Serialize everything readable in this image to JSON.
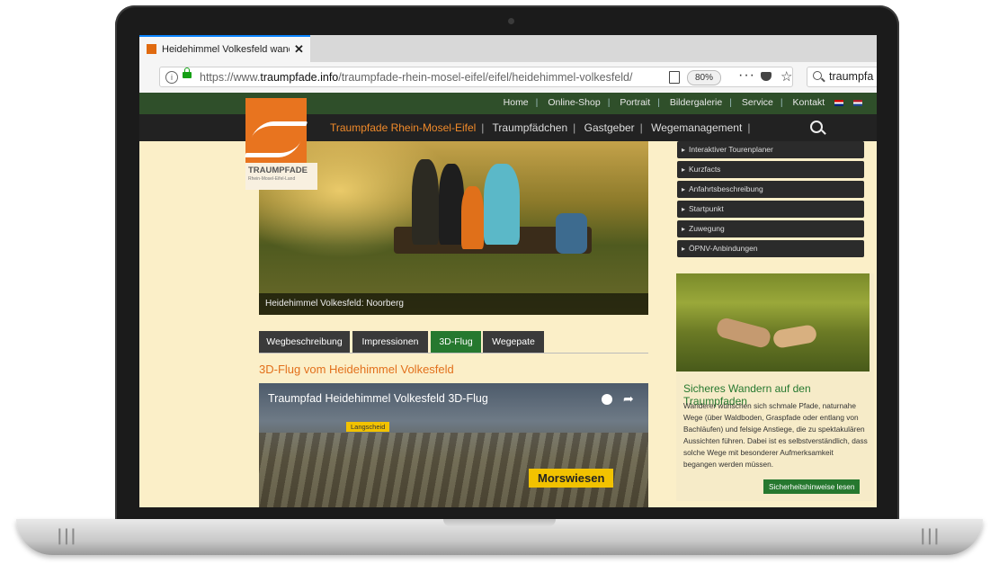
{
  "browser": {
    "tab_title": "Heidehimmel Volkesfeld wande",
    "tab_close": "✕",
    "url_domain": "traumpfade.info",
    "url_prefix": "https://www.",
    "url_path": "/traumpfade-rhein-mosel-eifel/eifel/heidehimmel-volkesfeld/",
    "zoom": "80%",
    "more": "···",
    "search_text": "traumpfa",
    "info_glyph": "i",
    "star_glyph": "☆"
  },
  "site": {
    "top_nav": [
      "Home",
      "Online-Shop",
      "Portrait",
      "Bildergalerie",
      "Service",
      "Kontakt"
    ],
    "main_nav": [
      "Traumpfade Rhein-Mosel-Eifel",
      "Traumpfädchen",
      "Gastgeber",
      "Wegemanagement"
    ],
    "logo_text": "TRAUMPFADE",
    "logo_sub": "Rhein-Mosel-Eifel-Land",
    "hero_caption": "Heidehimmel Volkesfeld: Noorberg",
    "page_tabs": [
      "Wegbeschreibung",
      "Impressionen",
      "3D-Flug",
      "Wegepate"
    ],
    "active_tab": "3D-Flug",
    "flight_heading": "3D-Flug vom Heidehimmel Volkesfeld",
    "video": {
      "title": "Traumpfad Heidehimmel Volkesfeld 3D-Flug",
      "label_small": "Langscheid",
      "label_big": "Morswiesen",
      "share_glyph": "➦"
    },
    "sidebar_links": [
      "Interaktiver Tourenplaner",
      "Kurzfacts",
      "Anfahrtsbeschreibung",
      "Startpunkt",
      "Zuwegung",
      "ÖPNV-Anbindungen"
    ],
    "safety": {
      "heading": "Sicheres Wandern auf den Traumpfaden",
      "text": "Wanderer wünschen sich schmale Pfade, naturnahe Wege (über Waldboden, Graspfade oder entlang von Bachläufen) und felsige Anstiege, die zu spektakulären Aussichten führen. Dabei ist es selbstverständlich, dass solche Wege mit besonderer Aufmerksamkeit begangen werden müssen.",
      "button": "Sicherheitshinweise lesen"
    }
  },
  "colors": {
    "accent_orange": "#e2701c",
    "accent_green": "#26782f",
    "top_bar": "#2f4f2a",
    "page_bg": "#fbefc8"
  },
  "laptop_grille": "|||"
}
